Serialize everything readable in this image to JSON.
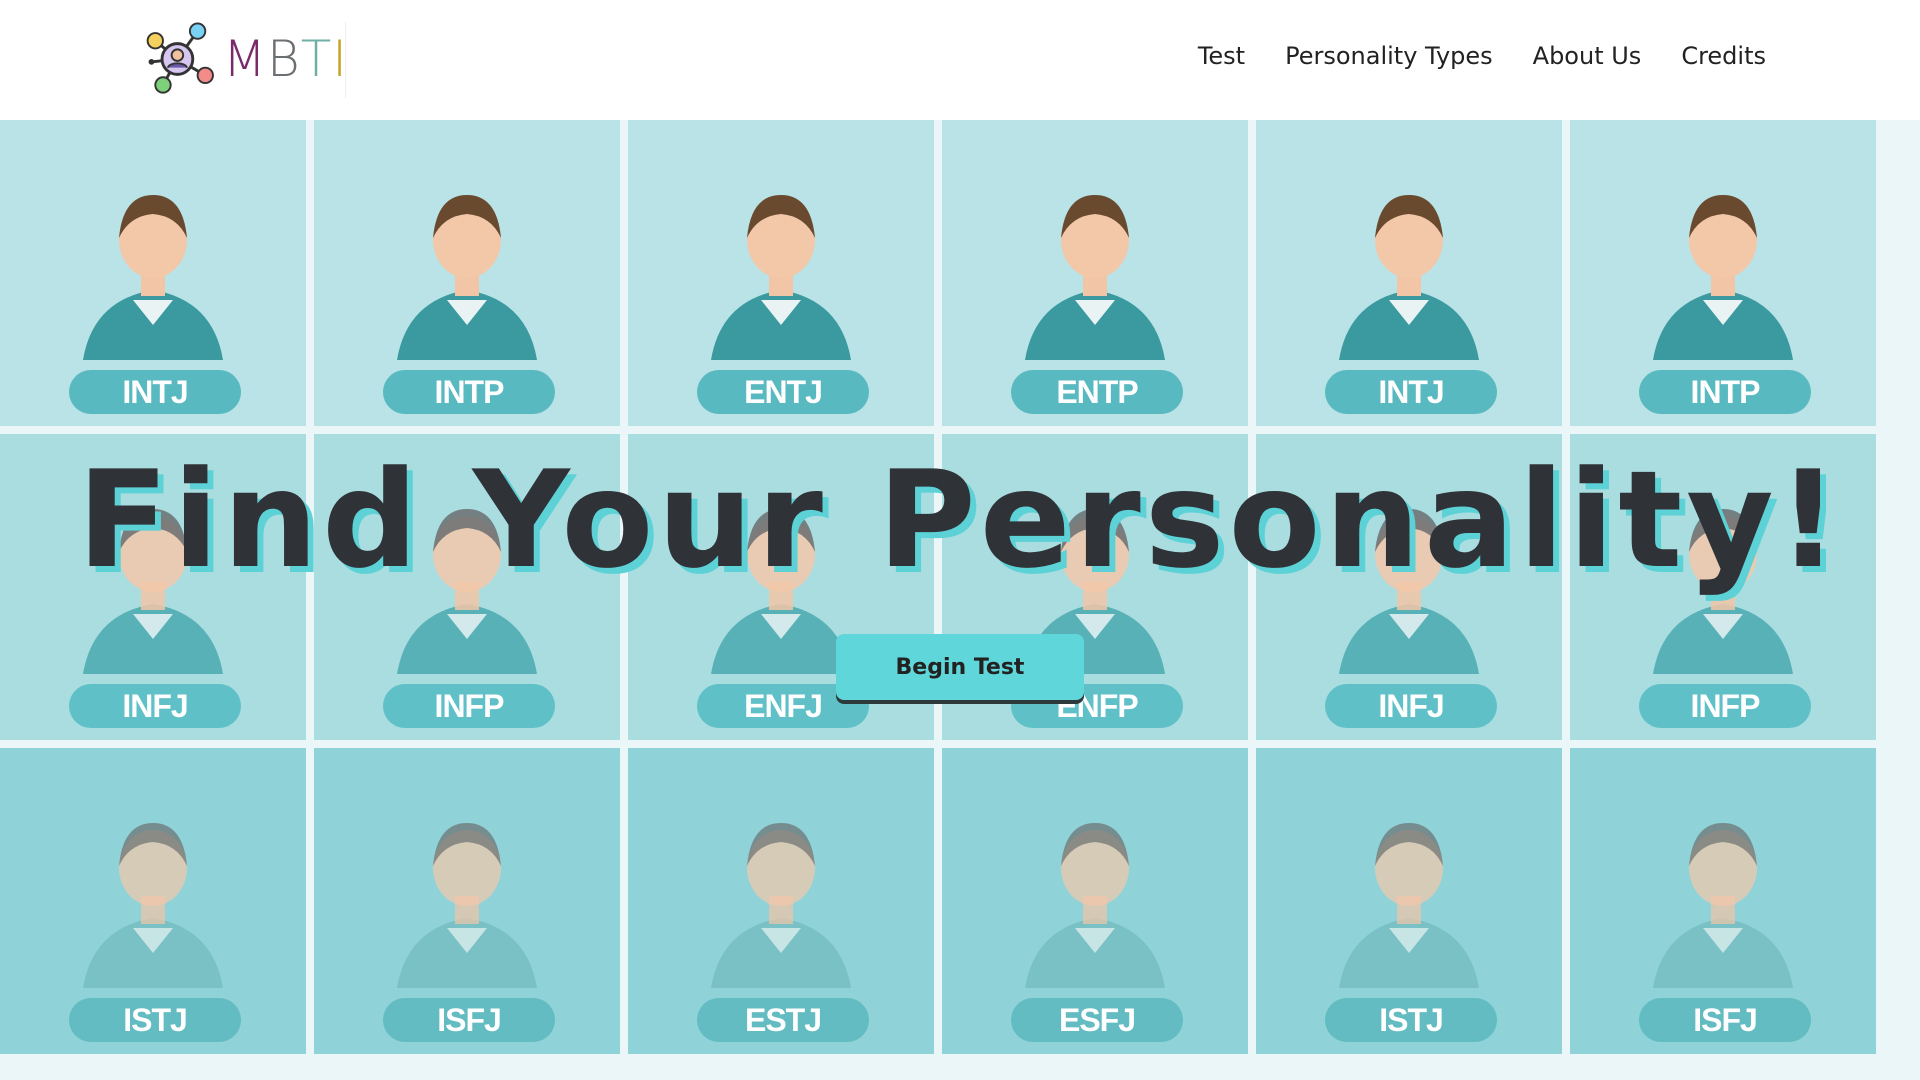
{
  "header": {
    "logo_text": "MBTI",
    "logo_colors": [
      "#8b2e63",
      "#7a2a6a",
      "#6fb0a6",
      "#c6a52c"
    ],
    "nav": [
      "Test",
      "Personality Types",
      "About Us",
      "Credits"
    ]
  },
  "hero": {
    "headline": "Find Your Personality!",
    "cta_label": "Begin Test",
    "tiles": [
      {
        "label": "INTJ",
        "figure": "woman-engineer-icon",
        "tone": "#b9e3e6",
        "badge": "#59b9c0"
      },
      {
        "label": "INTP",
        "figure": "scientist-icon",
        "tone": "#b9e3e6",
        "badge": "#59b9c0"
      },
      {
        "label": "ENTJ",
        "figure": "teacher-icon",
        "tone": "#b9e3e6",
        "badge": "#59b9c0"
      },
      {
        "label": "ENTP",
        "figure": "thinker-icon",
        "tone": "#b9e3e6",
        "badge": "#59b9c0"
      },
      {
        "label": "INTJ",
        "figure": "woman-engineer-icon",
        "tone": "#b9e3e6",
        "badge": "#59b9c0"
      },
      {
        "label": "INTP",
        "figure": "scientist-icon",
        "tone": "#b9e3e6",
        "badge": "#59b9c0"
      },
      {
        "label": "INFJ",
        "figure": "man-note-icon",
        "tone": "#a9dde0",
        "badge": "#5fc1c7"
      },
      {
        "label": "INFP",
        "figure": "woman-cheer-icon",
        "tone": "#a9dde0",
        "badge": "#5fc1c7"
      },
      {
        "label": "ENFJ",
        "figure": "knight-icon",
        "tone": "#a9dde0",
        "badge": "#5fc1c7"
      },
      {
        "label": "ENFP",
        "figure": "man-wave-icon",
        "tone": "#a9dde0",
        "badge": "#5fc1c7"
      },
      {
        "label": "INFJ",
        "figure": "man-note-icon",
        "tone": "#a9dde0",
        "badge": "#5fc1c7"
      },
      {
        "label": "INFP",
        "figure": "woman-cheer-icon",
        "tone": "#a9dde0",
        "badge": "#5fc1c7"
      },
      {
        "label": "ISTJ",
        "figure": "reader-icon",
        "tone": "#8fd3d8",
        "badge": "#63bcc1"
      },
      {
        "label": "ISFJ",
        "figure": "doctor-icon",
        "tone": "#8fd3d8",
        "badge": "#63bcc1"
      },
      {
        "label": "ESTJ",
        "figure": "manager-icon",
        "tone": "#8fd3d8",
        "badge": "#63bcc1"
      },
      {
        "label": "ESFJ",
        "figure": "gift-giver-icon",
        "tone": "#8fd3d8",
        "badge": "#63bcc1"
      },
      {
        "label": "ISTJ",
        "figure": "reader-icon",
        "tone": "#8fd3d8",
        "badge": "#63bcc1"
      },
      {
        "label": "ISFJ",
        "figure": "doctor-icon",
        "tone": "#8fd3d8",
        "badge": "#63bcc1"
      }
    ]
  }
}
